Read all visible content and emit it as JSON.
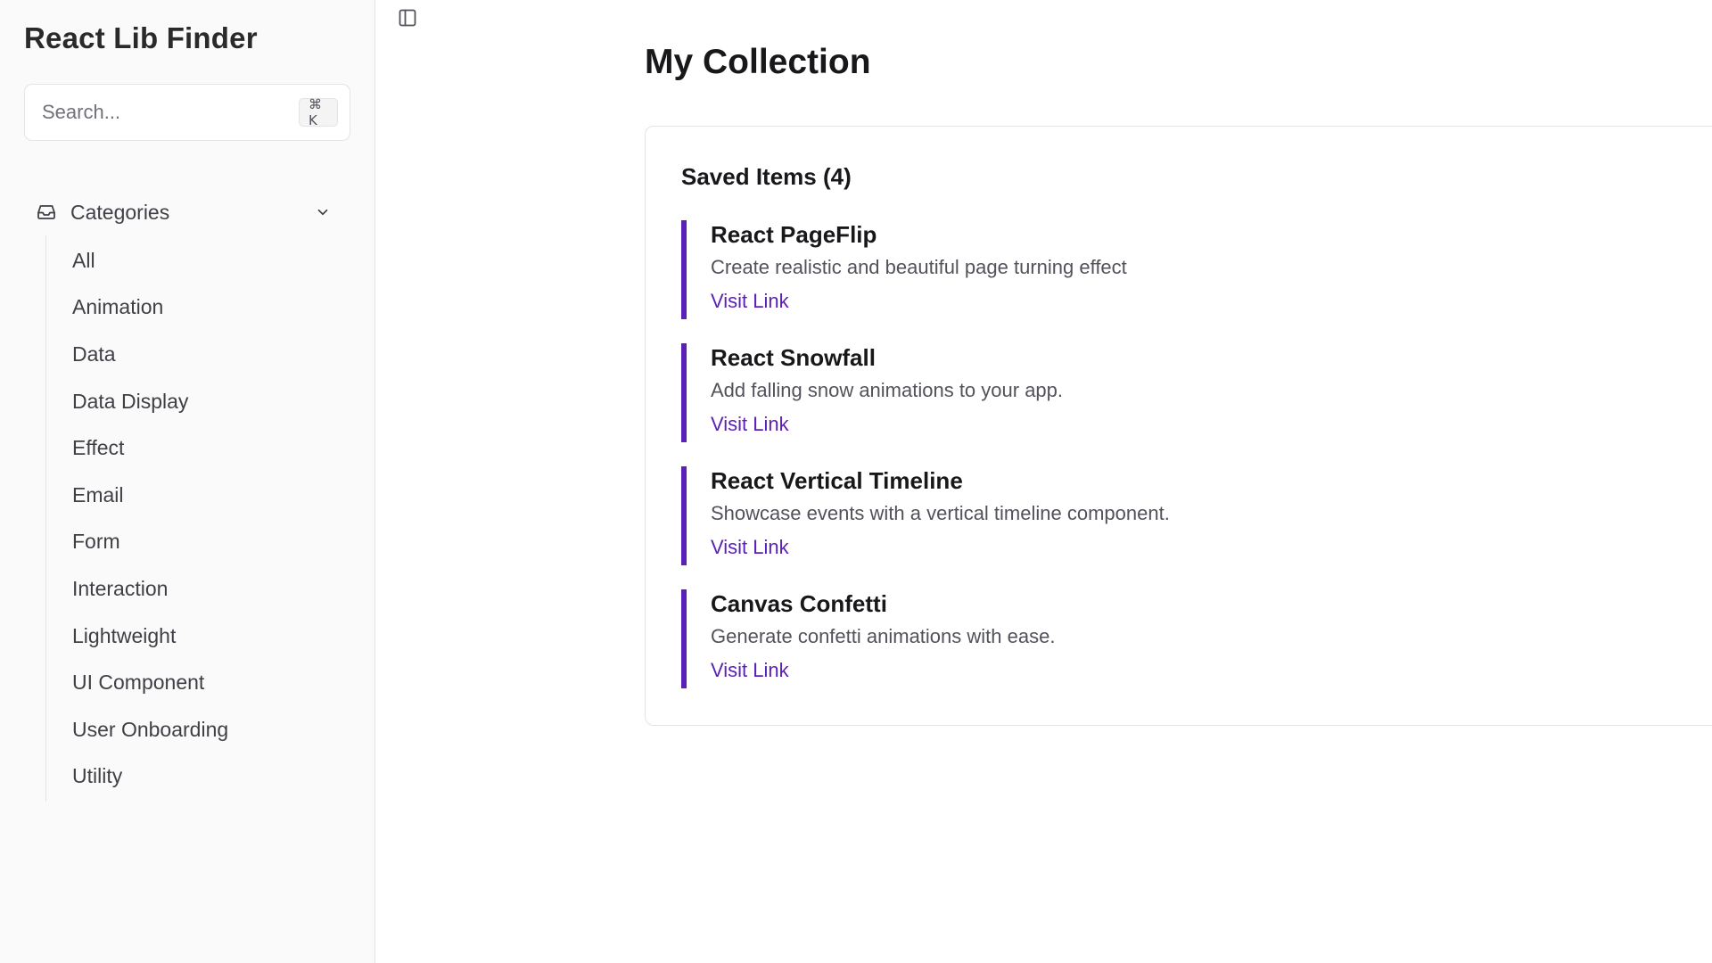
{
  "app": {
    "title": "React Lib Finder"
  },
  "search": {
    "placeholder": "Search...",
    "value": "",
    "shortcut": "⌘ K"
  },
  "sidebar": {
    "categories_label": "Categories",
    "categories_expanded": true,
    "items": [
      {
        "label": "All"
      },
      {
        "label": "Animation"
      },
      {
        "label": "Data"
      },
      {
        "label": "Data Display"
      },
      {
        "label": "Effect"
      },
      {
        "label": "Email"
      },
      {
        "label": "Form"
      },
      {
        "label": "Interaction"
      },
      {
        "label": "Lightweight"
      },
      {
        "label": "UI Component"
      },
      {
        "label": "User Onboarding"
      },
      {
        "label": "Utility"
      }
    ]
  },
  "main": {
    "title": "My Collection",
    "saved_heading": "Saved Items (4)",
    "saved_items": [
      {
        "title": "React PageFlip",
        "description": "Create realistic and beautiful page turning effect",
        "link_label": "Visit Link"
      },
      {
        "title": "React Snowfall",
        "description": "Add falling snow animations to your app.",
        "link_label": "Visit Link"
      },
      {
        "title": "React Vertical Timeline",
        "description": "Showcase events with a vertical timeline component.",
        "link_label": "Visit Link"
      },
      {
        "title": "Canvas Confetti",
        "description": "Generate confetti animations with ease.",
        "link_label": "Visit Link"
      }
    ]
  },
  "colors": {
    "accent": "#5b21b6",
    "sidebar_bg": "#fafafa",
    "border": "#e4e4e7"
  },
  "icons": {
    "sidebar_toggle": "sidebar-toggle-icon",
    "categories": "inbox-icon",
    "expand": "chevron-down-icon"
  }
}
